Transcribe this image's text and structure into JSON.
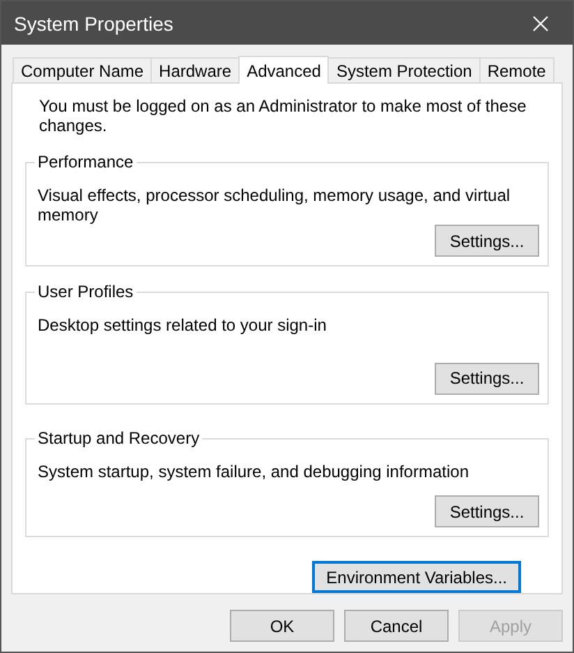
{
  "window": {
    "title": "System Properties"
  },
  "tabs": [
    {
      "label": "Computer Name",
      "selected": false
    },
    {
      "label": "Hardware",
      "selected": false
    },
    {
      "label": "Advanced",
      "selected": true
    },
    {
      "label": "System Protection",
      "selected": false
    },
    {
      "label": "Remote",
      "selected": false
    }
  ],
  "notice": "You must be logged on as an Administrator to make most of these changes.",
  "groups": [
    {
      "title": "Performance",
      "description": "Visual effects, processor scheduling, memory usage, and virtual memory",
      "button": "Settings..."
    },
    {
      "title": "User Profiles",
      "description": "Desktop settings related to your sign-in",
      "button": "Settings..."
    },
    {
      "title": "Startup and Recovery",
      "description": "System startup, system failure, and debugging information",
      "button": "Settings..."
    }
  ],
  "environment_button": {
    "label": "Environment Variables...",
    "focused": true
  },
  "footer_buttons": [
    {
      "label": "OK",
      "disabled": false
    },
    {
      "label": "Cancel",
      "disabled": false
    },
    {
      "label": "Apply",
      "disabled": true
    }
  ]
}
